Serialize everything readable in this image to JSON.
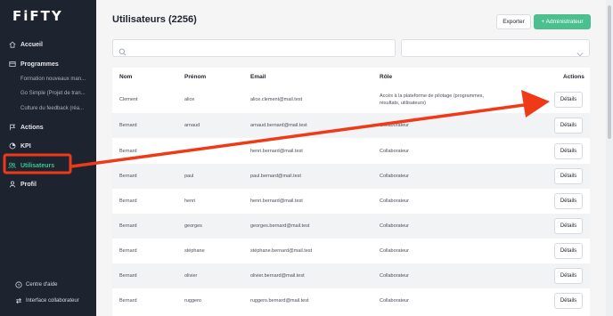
{
  "app": {
    "logo": "FiFTY"
  },
  "sidebar": {
    "items": [
      {
        "label": "Accueil",
        "icon": "home-icon"
      },
      {
        "label": "Programmes",
        "icon": "programs-icon"
      },
      {
        "label": "Actions",
        "icon": "actions-icon"
      },
      {
        "label": "KPI",
        "icon": "kpi-icon"
      },
      {
        "label": "Utilisateurs",
        "icon": "users-icon",
        "active": true
      },
      {
        "label": "Profil",
        "icon": "profile-icon"
      }
    ],
    "programmes": [
      "Formation nouveaux man...",
      "Go Simple (Projet de tran...",
      "Culture du feedback (réa..."
    ],
    "bottom": [
      {
        "label": "Centre d'aide",
        "icon": "help-icon"
      },
      {
        "label": "Interface collaborateur",
        "icon": "switch-icon"
      }
    ]
  },
  "header": {
    "title": "Utilisateurs (2256)",
    "export_label": "Exporter",
    "add_admin_label": "+ Administrateur"
  },
  "filters": {
    "search_placeholder": "",
    "select_value": ""
  },
  "table": {
    "columns": {
      "nom": "Nom",
      "prenom": "Prénom",
      "email": "Email",
      "role": "Rôle",
      "actions": "Actions"
    },
    "details_label": "Détails",
    "rows": [
      {
        "nom": "Clement",
        "prenom": "alice",
        "email": "alice.clement@mail.test",
        "role": "Accès à la plateforme de pilotage (programmes, résultats, utilisateurs)"
      },
      {
        "nom": "Bernard",
        "prenom": "arnaud",
        "email": "arnaud.bernard@mail.test",
        "role": "Collaborateur"
      },
      {
        "nom": "Bernard",
        "prenom": "",
        "email": "henri.bernard@mail.test",
        "role": "Collaborateur"
      },
      {
        "nom": "Bernard",
        "prenom": "paul",
        "email": "paul.bernard@mail.test",
        "role": "Collaborateur"
      },
      {
        "nom": "Bernard",
        "prenom": "henri",
        "email": "henri.bernard@mail.test",
        "role": "Collaborateur"
      },
      {
        "nom": "Bernard",
        "prenom": "georges",
        "email": "georges.bernard@mail.test",
        "role": "Collaborateur"
      },
      {
        "nom": "Bernard",
        "prenom": "stéphane",
        "email": "stéphane.bernard@mail.test",
        "role": "Collaborateur"
      },
      {
        "nom": "Bernard",
        "prenom": "olivier",
        "email": "olivier.bernard@mail.test",
        "role": "Collaborateur"
      },
      {
        "nom": "Bernard",
        "prenom": "ruggero",
        "email": "ruggero.bernard@mail.test",
        "role": "Collaborateur"
      }
    ]
  },
  "colors": {
    "accent": "#4cbf8f",
    "active_nav": "#3cc48f",
    "annotation": "#f03a17",
    "sidebar_bg": "#1e2330"
  }
}
